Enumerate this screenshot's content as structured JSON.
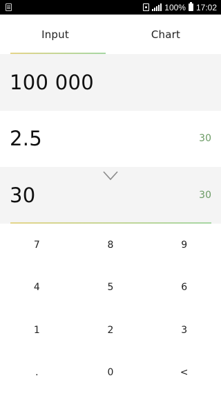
{
  "status_bar": {
    "battery": "100%",
    "time": "17:02",
    "icons": [
      "app-notification-icon",
      "sim-icon",
      "signal-icon",
      "battery-icon"
    ]
  },
  "tabs": [
    {
      "label": "Input",
      "selected": true
    },
    {
      "label": "Chart",
      "selected": false
    }
  ],
  "fields": [
    {
      "value": "100 000",
      "aux": ""
    },
    {
      "value": "2.5",
      "aux": "30"
    },
    {
      "value": "30",
      "aux": "30"
    }
  ],
  "keypad": {
    "keys": [
      "7",
      "8",
      "9",
      "4",
      "5",
      "6",
      "1",
      "2",
      "3",
      ".",
      "0",
      "<"
    ]
  },
  "colors": {
    "accent_gradient_start": "#e4d58a",
    "accent_gradient_end": "#a6d6a3",
    "aux_text": "#6a9a63",
    "shaded_row": "#f4f4f4"
  }
}
